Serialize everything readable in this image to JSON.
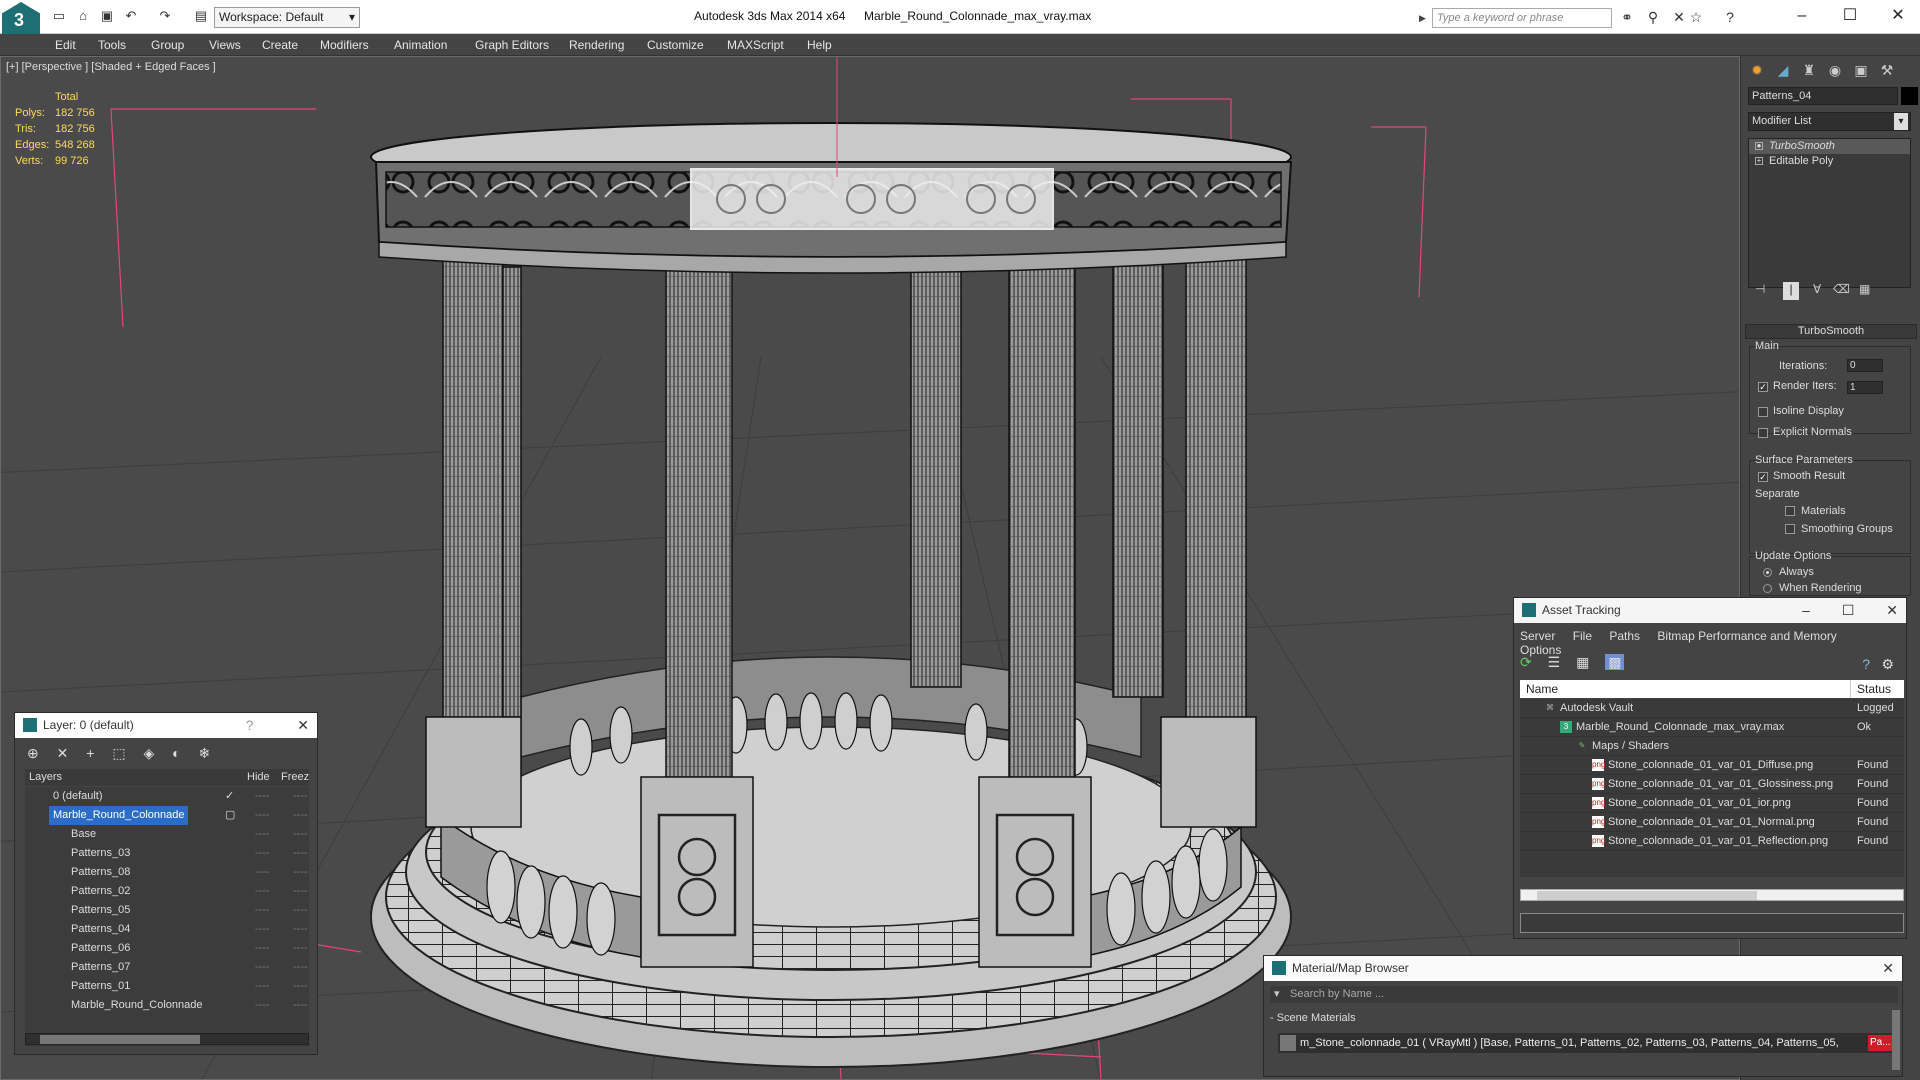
{
  "titlebar": {
    "workspace_label": "Workspace: Default",
    "app_title": "Autodesk 3ds Max  2014 x64",
    "file_title": "Marble_Round_Colonnade_max_vray.max",
    "search_placeholder": "Type a keyword or phrase",
    "quick_access_icons": [
      "new-file-icon",
      "open-file-icon",
      "save-icon",
      "undo-icon",
      "redo-icon",
      "project-folder-icon"
    ],
    "info_icons": [
      "binoculars-icon",
      "sign-in-icon",
      "exchange-icon",
      "favorites-icon",
      "help-icon"
    ]
  },
  "menu": [
    "Edit",
    "Tools",
    "Group",
    "Views",
    "Create",
    "Modifiers",
    "Animation",
    "Graph Editors",
    "Rendering",
    "Customize",
    "MAXScript",
    "Help"
  ],
  "viewport": {
    "label": "[+] [Perspective ] [Shaded + Edged Faces ]",
    "stats": {
      "header": "Total",
      "rows": [
        {
          "k": "Polys:",
          "v": "182 756"
        },
        {
          "k": "Tris:",
          "v": "182 756"
        },
        {
          "k": "Edges:",
          "v": "548 268"
        },
        {
          "k": "Verts:",
          "v": "99 726"
        }
      ]
    }
  },
  "command_panel": {
    "tabs": [
      "create-icon",
      "modify-icon",
      "hierarchy-icon",
      "motion-icon",
      "display-icon",
      "utilities-icon"
    ],
    "object_name": "Patterns_04",
    "modifier_list": "Modifier List",
    "stack": [
      "TurboSmooth",
      "Editable Poly"
    ],
    "rollout_title": "TurboSmooth",
    "main_label": "Main",
    "iterations_label": "Iterations:",
    "iterations_value": "0",
    "render_iters_label": "Render Iters:",
    "render_iters_value": "1",
    "isoline_label": "Isoline Display",
    "explicit_label": "Explicit Normals",
    "surface_label": "Surface Parameters",
    "smooth_label": "Smooth Result",
    "separate_label": "Separate",
    "materials_label": "Materials",
    "smoothing_label": "Smoothing Groups",
    "update_label": "Update Options",
    "always_label": "Always",
    "when_rendering_label": "When Rendering"
  },
  "layer_window": {
    "title": "Layer: 0 (default)",
    "help": "?",
    "col_layers": "Layers",
    "col_hide": "Hide",
    "col_freeze": "Freez",
    "rows": [
      {
        "name": "0 (default)",
        "indent": 1
      },
      {
        "name": "Marble_Round_Colonnade",
        "indent": 1
      },
      {
        "name": "Base",
        "indent": 2
      },
      {
        "name": "Patterns_03",
        "indent": 2
      },
      {
        "name": "Patterns_08",
        "indent": 2
      },
      {
        "name": "Patterns_02",
        "indent": 2
      },
      {
        "name": "Patterns_05",
        "indent": 2
      },
      {
        "name": "Patterns_04",
        "indent": 2
      },
      {
        "name": "Patterns_06",
        "indent": 2
      },
      {
        "name": "Patterns_07",
        "indent": 2
      },
      {
        "name": "Patterns_01",
        "indent": 2
      },
      {
        "name": "Marble_Round_Colonnade",
        "indent": 2
      }
    ],
    "dash": "----"
  },
  "asset_window": {
    "title": "Asset Tracking",
    "menu": [
      "Server",
      "File",
      "Paths",
      "Bitmap Performance and Memory",
      "Options"
    ],
    "col_name": "Name",
    "col_status": "Status",
    "rows": [
      {
        "name": "Autodesk Vault",
        "status": "Logged",
        "indent": 1
      },
      {
        "name": "Marble_Round_Colonnade_max_vray.max",
        "status": "Ok",
        "indent": 2
      },
      {
        "name": "Maps / Shaders",
        "status": "",
        "indent": 3
      },
      {
        "name": "Stone_colonnade_01_var_01_Diffuse.png",
        "status": "Found",
        "indent": 4
      },
      {
        "name": "Stone_colonnade_01_var_01_Glossiness.png",
        "status": "Found",
        "indent": 4
      },
      {
        "name": "Stone_colonnade_01_var_01_ior.png",
        "status": "Found",
        "indent": 4
      },
      {
        "name": "Stone_colonnade_01_var_01_Normal.png",
        "status": "Found",
        "indent": 4
      },
      {
        "name": "Stone_colonnade_01_var_01_Reflection.png",
        "status": "Found",
        "indent": 4
      }
    ]
  },
  "material_window": {
    "title": "Material/Map Browser",
    "search_placeholder": "Search by Name ...",
    "section": "- Scene Materials",
    "material_text": "m_Stone_colonnade_01  ( VRayMtl )  [Base, Patterns_01, Patterns_02, Patterns_03, Patterns_04, Patterns_05,",
    "material_tail": "Pa..."
  },
  "colors": {
    "selection": "#2a6cc7",
    "stats": "#ffd95a",
    "accent": "#1d6f73"
  }
}
